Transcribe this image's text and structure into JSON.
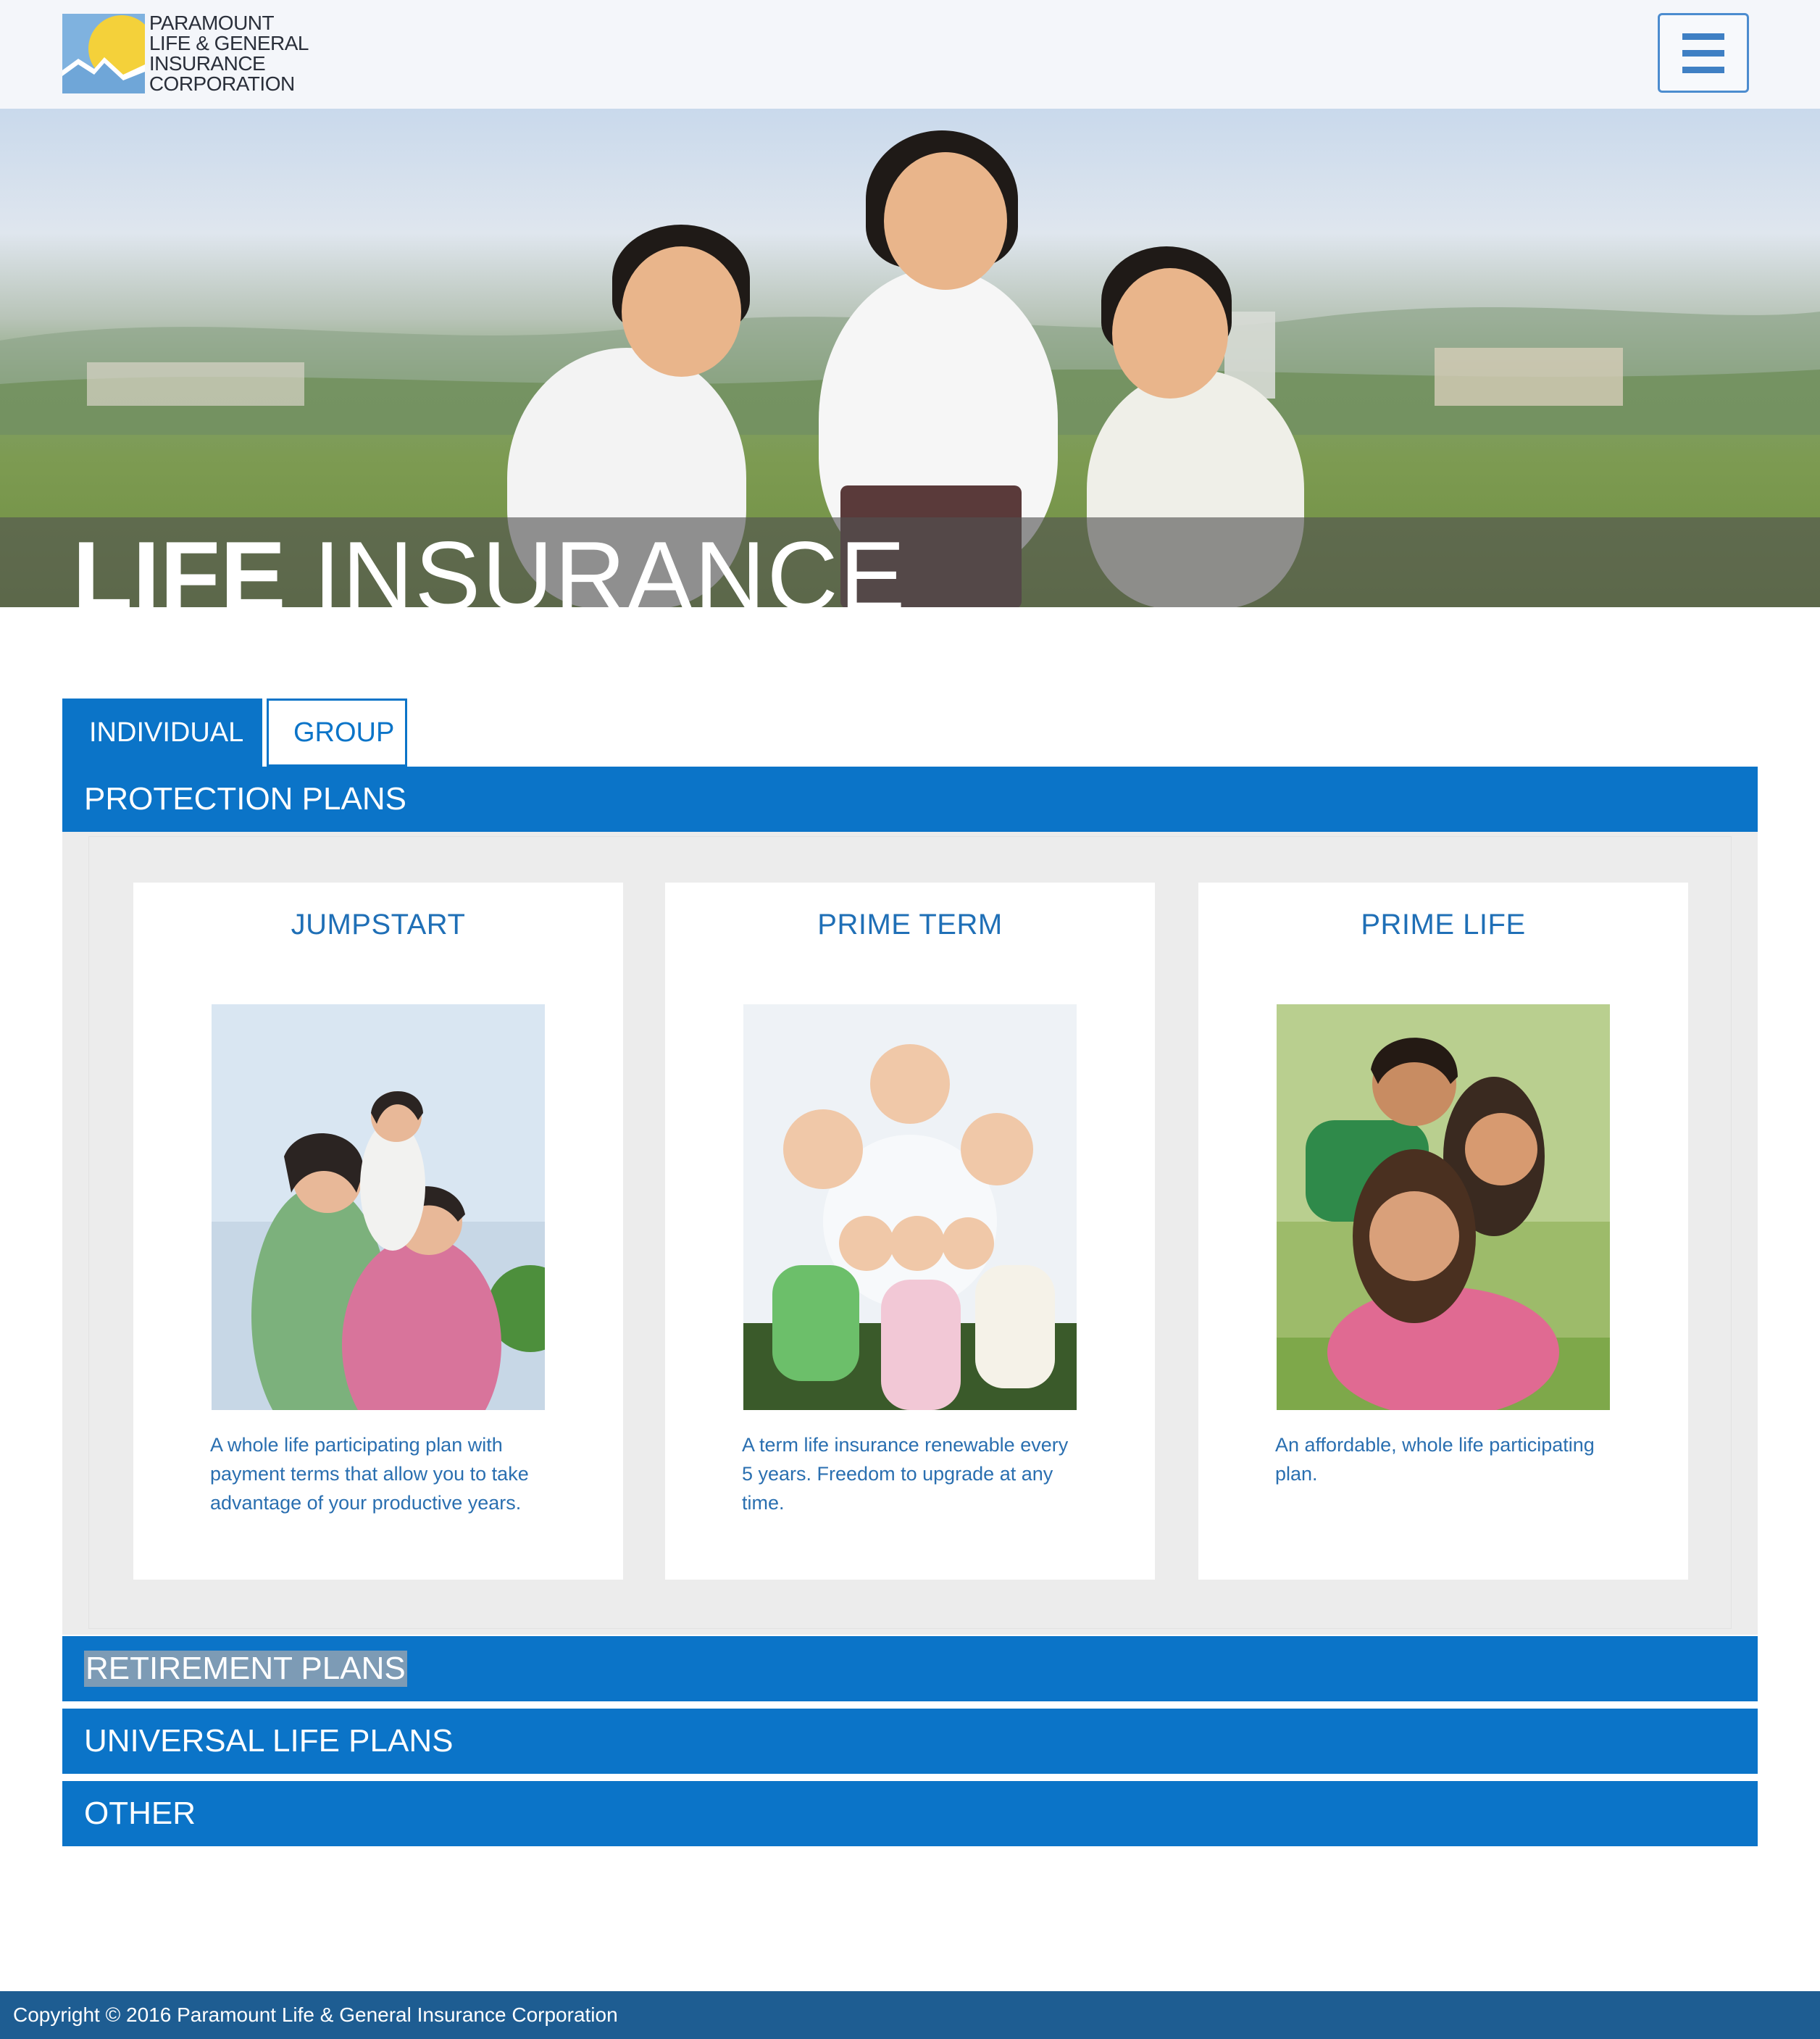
{
  "header": {
    "logo_lines": [
      "PARAMOUNT",
      "LIFE & GENERAL",
      "INSURANCE",
      "CORPORATION"
    ],
    "menu_icon": "hamburger-menu-icon"
  },
  "hero": {
    "title_bold": "LIFE",
    "title_light": "INSURANCE"
  },
  "tabs": [
    {
      "label": "INDIVIDUAL",
      "active": true
    },
    {
      "label": "GROUP",
      "active": false
    }
  ],
  "accordion": {
    "protection": "PROTECTION PLANS",
    "retirement": "RETIREMENT PLANS",
    "universal": "UNIVERSAL LIFE PLANS",
    "other": "OTHER"
  },
  "cards": [
    {
      "title": "JUMPSTART",
      "description": "A whole life participating plan with payment terms that allow you to take advantage of your productive years."
    },
    {
      "title": "PRIME TERM",
      "description": "A term life insurance renewable every 5 years. Freedom to upgrade at any time."
    },
    {
      "title": "PRIME LIFE",
      "description": "An affordable, whole life participating plan."
    }
  ],
  "footer": {
    "copyright": "Copyright © 2016 Paramount Life & General Insurance Corporation"
  },
  "colors": {
    "primary_blue": "#0b74c8",
    "footer_blue": "#1e5d92",
    "panel_gray": "#ececec"
  }
}
